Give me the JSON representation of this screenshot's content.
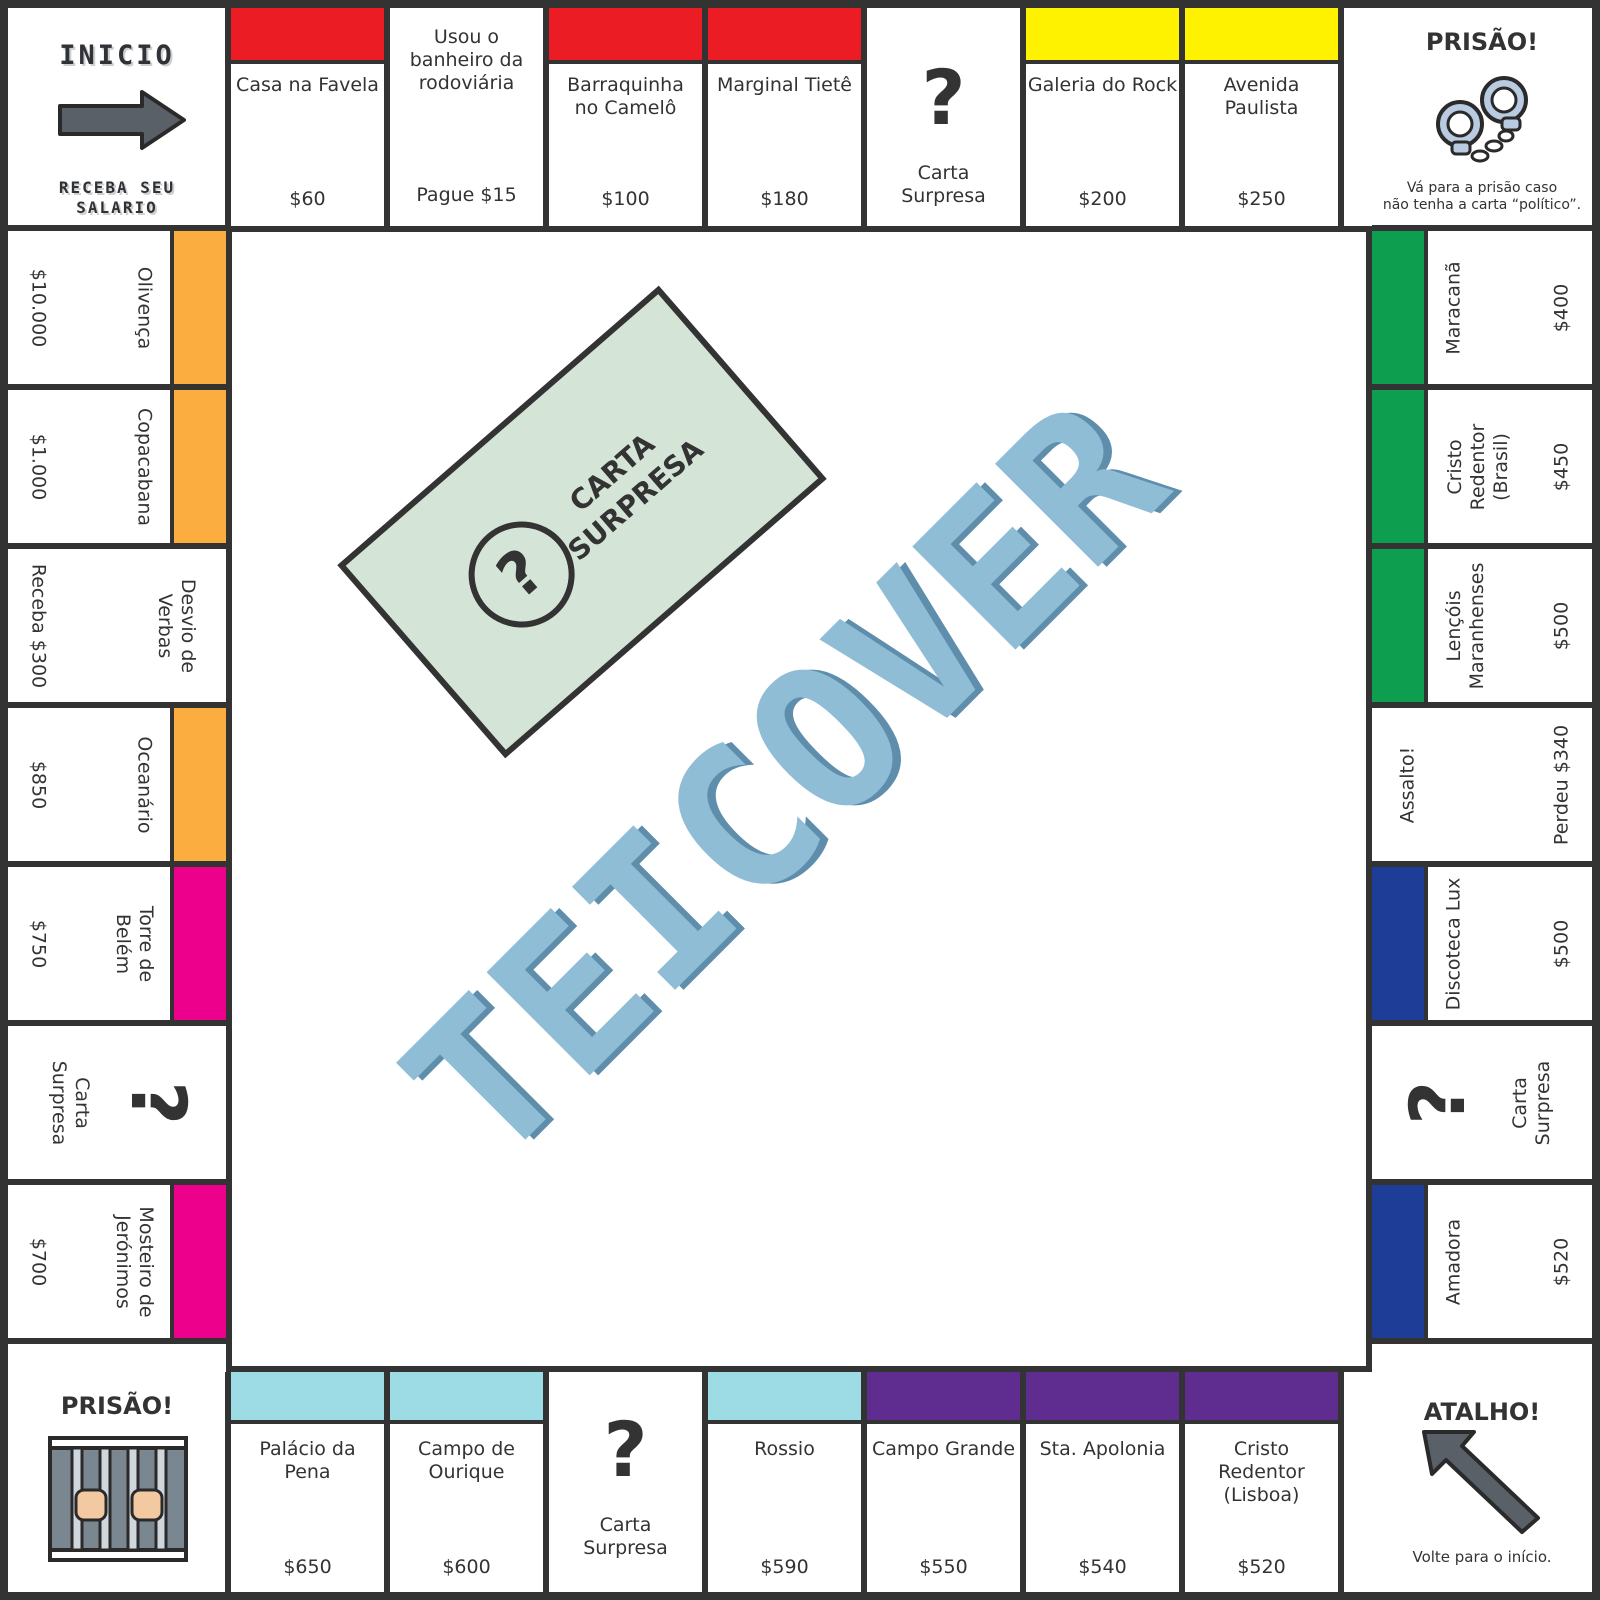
{
  "colors": {
    "red": "#ec1c24",
    "yellow": "#fff200",
    "orange": "#fbae3f",
    "magenta": "#ec008c",
    "green": "#0d9e4f",
    "navy": "#1e3d96",
    "light_blue": "#9ddbe5",
    "purple": "#5f2d8f",
    "card_fill": "#d4e5d8",
    "logo_fill": "#8fbdd6",
    "line": "#333333"
  },
  "logo": {
    "text": "TEICOVER"
  },
  "center_card": {
    "text_line1": "CARTA",
    "text_line2": "SURPRESA",
    "icon": "question-circle-icon"
  },
  "corners": {
    "start": {
      "title": "INICIO",
      "caption": "RECEBA SEU\nSALARIO",
      "icon": "right-arrow-icon"
    },
    "jail_go": {
      "title": "PRISÃO!",
      "caption": "Vá para a prisão caso\nnão tenha a carta “político”.",
      "icon": "handcuffs-icon"
    },
    "jail": {
      "title": "PRISÃO!",
      "icon": "jail-cell-icon"
    },
    "shortcut": {
      "title": "ATALHO!",
      "caption": "Volte para o início.",
      "icon": "up-left-arrow-icon"
    }
  },
  "top": [
    {
      "name": "Casa na Favela",
      "price": "$60",
      "color": "red"
    },
    {
      "name": "Usou o\nbanheiro da\nrodoviária",
      "price": "Pague $15",
      "color": ""
    },
    {
      "name": "Barraquinha\nno Camelô",
      "price": "$100",
      "color": "red"
    },
    {
      "name": "Marginal Tietê",
      "price": "$180",
      "color": "red"
    },
    {
      "name": "Carta\nSurpresa",
      "price": "",
      "color": "",
      "question": "?"
    },
    {
      "name": "Galeria do Rock",
      "price": "$200",
      "color": "yellow"
    },
    {
      "name": "Avenida\nPaulista",
      "price": "$250",
      "color": "yellow"
    }
  ],
  "left": [
    {
      "name": "Olivença",
      "price": "$10.000",
      "color": "orange"
    },
    {
      "name": "Copacabana",
      "price": "$1.000",
      "color": "orange"
    },
    {
      "name": "Desvio de\nVerbas",
      "price": "Receba $300",
      "color": ""
    },
    {
      "name": "Oceanário",
      "price": "$850",
      "color": "orange"
    },
    {
      "name": "Torre de\nBelém",
      "price": "$750",
      "color": "magenta"
    },
    {
      "name": "Carta\nSurpresa",
      "price": "",
      "color": "",
      "question": "?"
    },
    {
      "name": "Mosteiro de\nJerónimos",
      "price": "$700",
      "color": "magenta"
    }
  ],
  "right": [
    {
      "name": "Maracanã",
      "price": "$400",
      "color": "green"
    },
    {
      "name": "Cristo\nRedentor\n(Brasil)",
      "price": "$450",
      "color": "green"
    },
    {
      "name": "Lençóis\nMaranhenses",
      "price": "$500",
      "color": "green"
    },
    {
      "name": "Assalto!",
      "price": "Perdeu $340",
      "color": ""
    },
    {
      "name": "Discoteca Lux",
      "price": "$500",
      "color": "navy"
    },
    {
      "name": "Carta\nSurpresa",
      "price": "",
      "color": "",
      "question": "?"
    },
    {
      "name": "Amadora",
      "price": "$520",
      "color": "navy"
    }
  ],
  "bottom": [
    {
      "name": "Palácio da\nPena",
      "price": "$650",
      "color": "light_blue"
    },
    {
      "name": "Campo de\nOurique",
      "price": "$600",
      "color": "light_blue"
    },
    {
      "name": "Carta\nSurpresa",
      "price": "",
      "color": "",
      "question": "?"
    },
    {
      "name": "Rossio",
      "price": "$590",
      "color": "light_blue"
    },
    {
      "name": "Campo Grande",
      "price": "$550",
      "color": "purple"
    },
    {
      "name": "Sta. Apolonia",
      "price": "$540",
      "color": "purple"
    },
    {
      "name": "Cristo\nRedentor\n(Lisboa)",
      "price": "$520",
      "color": "purple"
    }
  ]
}
